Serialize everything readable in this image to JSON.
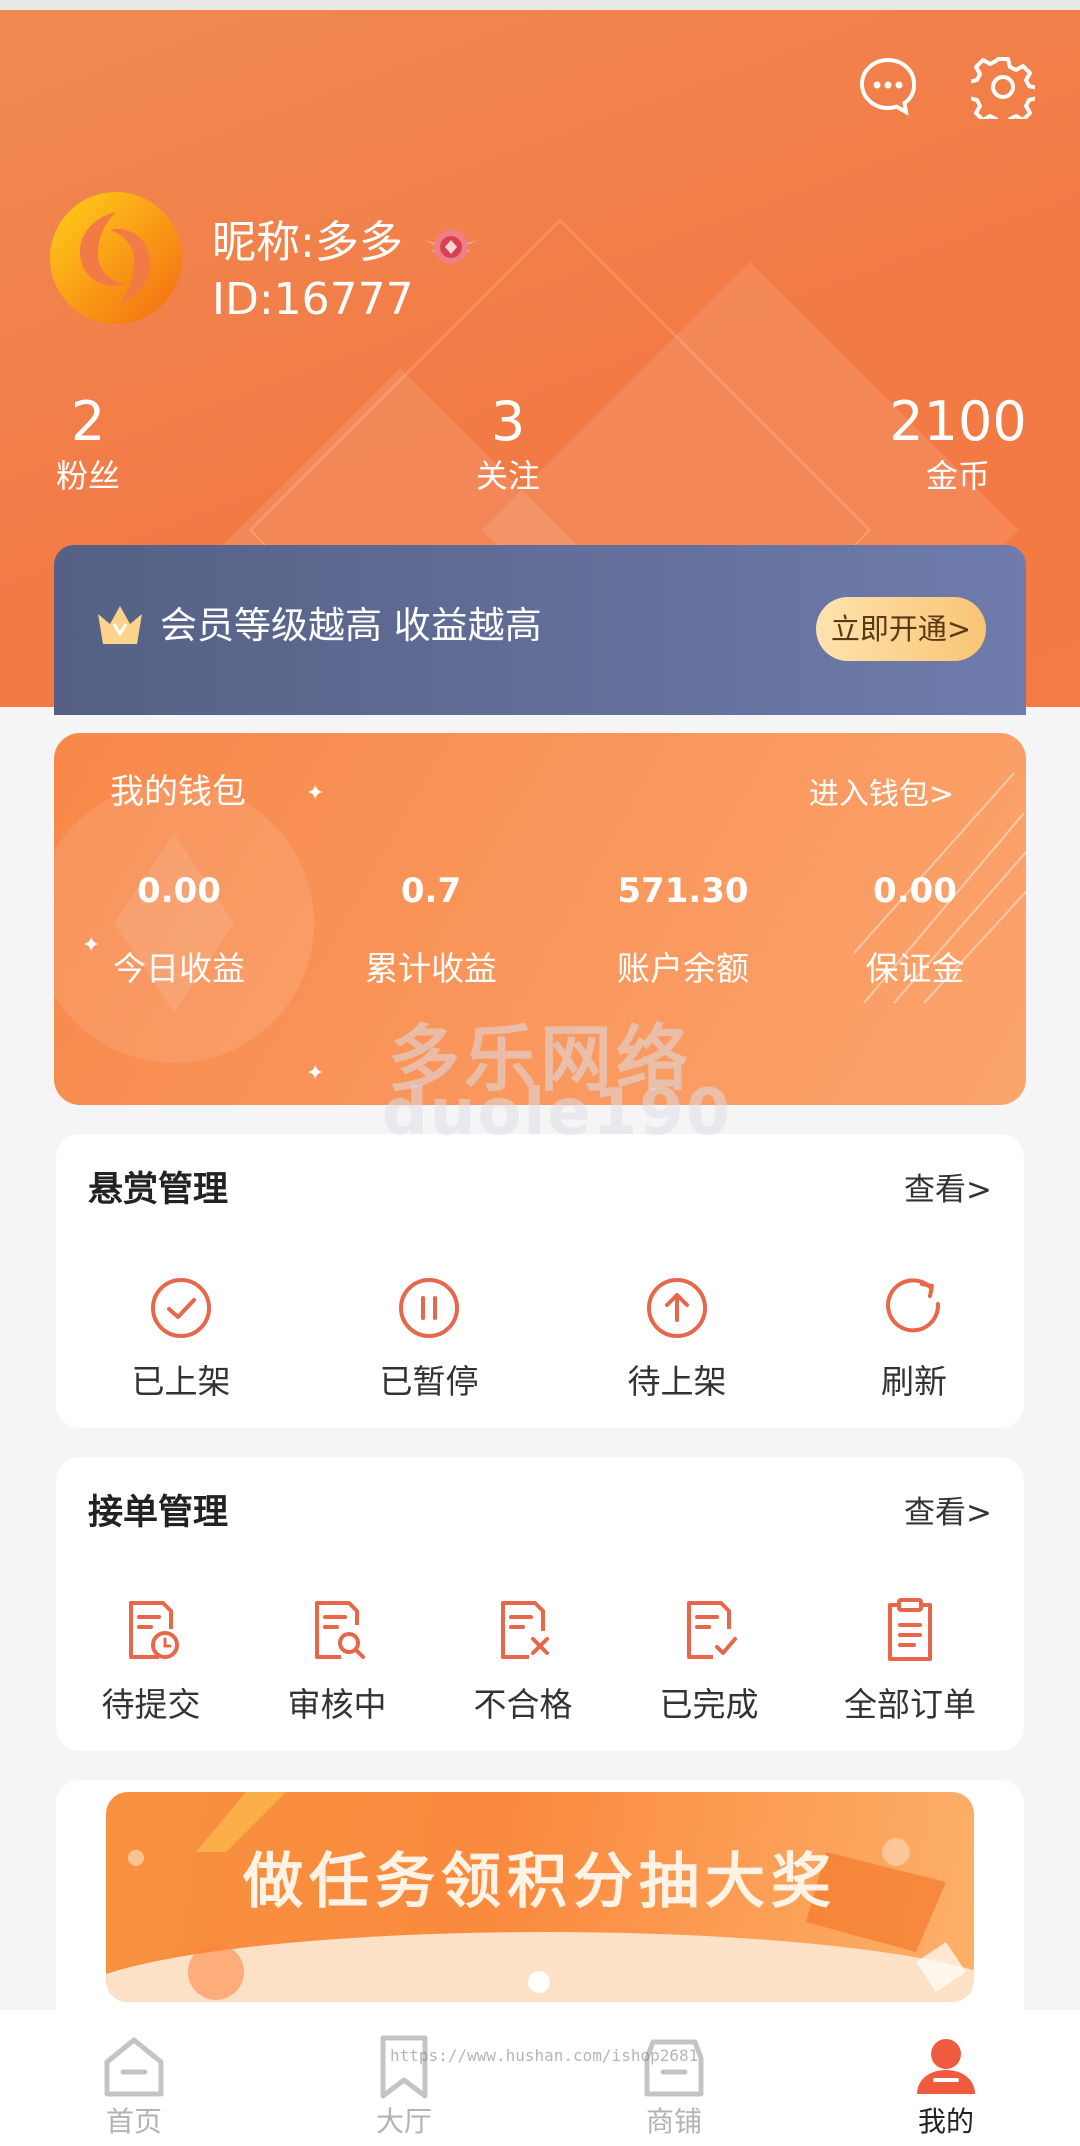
{
  "header": {
    "nickname": "昵称:多多",
    "user_id": "ID:16777",
    "icons": [
      "chat-icon",
      "gear-icon"
    ]
  },
  "stats": [
    {
      "value": "2",
      "label": "粉丝"
    },
    {
      "value": "3",
      "label": "关注"
    },
    {
      "value": "2100",
      "label": "金币"
    }
  ],
  "vip_banner": {
    "text": "会员等级越高 收益越高",
    "button": "立即开通>"
  },
  "wallet": {
    "title": "我的钱包",
    "link": "进入钱包>",
    "items": [
      {
        "value": "0.00",
        "label": "今日收益"
      },
      {
        "value": "0.7",
        "label": "累计收益"
      },
      {
        "value": "571.30",
        "label": "账户余额"
      },
      {
        "value": "0.00",
        "label": "保证金"
      }
    ]
  },
  "reward_mgmt": {
    "title": "悬赏管理",
    "more": "查看>",
    "items": [
      {
        "label": "已上架",
        "icon": "check-circle-icon"
      },
      {
        "label": "已暂停",
        "icon": "pause-circle-icon"
      },
      {
        "label": "待上架",
        "icon": "upload-circle-icon"
      },
      {
        "label": "刷新",
        "icon": "refresh-icon"
      }
    ]
  },
  "order_mgmt": {
    "title": "接单管理",
    "more": "查看>",
    "items": [
      {
        "label": "待提交",
        "icon": "doc-clock-icon"
      },
      {
        "label": "审核中",
        "icon": "doc-search-icon"
      },
      {
        "label": "不合格",
        "icon": "doc-x-icon"
      },
      {
        "label": "已完成",
        "icon": "doc-check-icon"
      },
      {
        "label": "全部订单",
        "icon": "clipboard-icon"
      }
    ]
  },
  "promo_banner": {
    "text": "做任务领积分抽大奖"
  },
  "watermark": {
    "line1": "多乐网络",
    "line2": "duole190",
    "url": "https://www.hushan.com/ishop2681"
  },
  "tabbar": [
    {
      "label": "首页",
      "icon": "home-icon",
      "active": false
    },
    {
      "label": "大厅",
      "icon": "bookmark-icon",
      "active": false
    },
    {
      "label": "商铺",
      "icon": "shop-icon",
      "active": false
    },
    {
      "label": "我的",
      "icon": "user-icon",
      "active": true
    }
  ],
  "colors": {
    "accent": "#f27a45",
    "icon_accent": "#e8664a",
    "vip_bg": "#626d98",
    "vip_button": "#fbd08b"
  }
}
